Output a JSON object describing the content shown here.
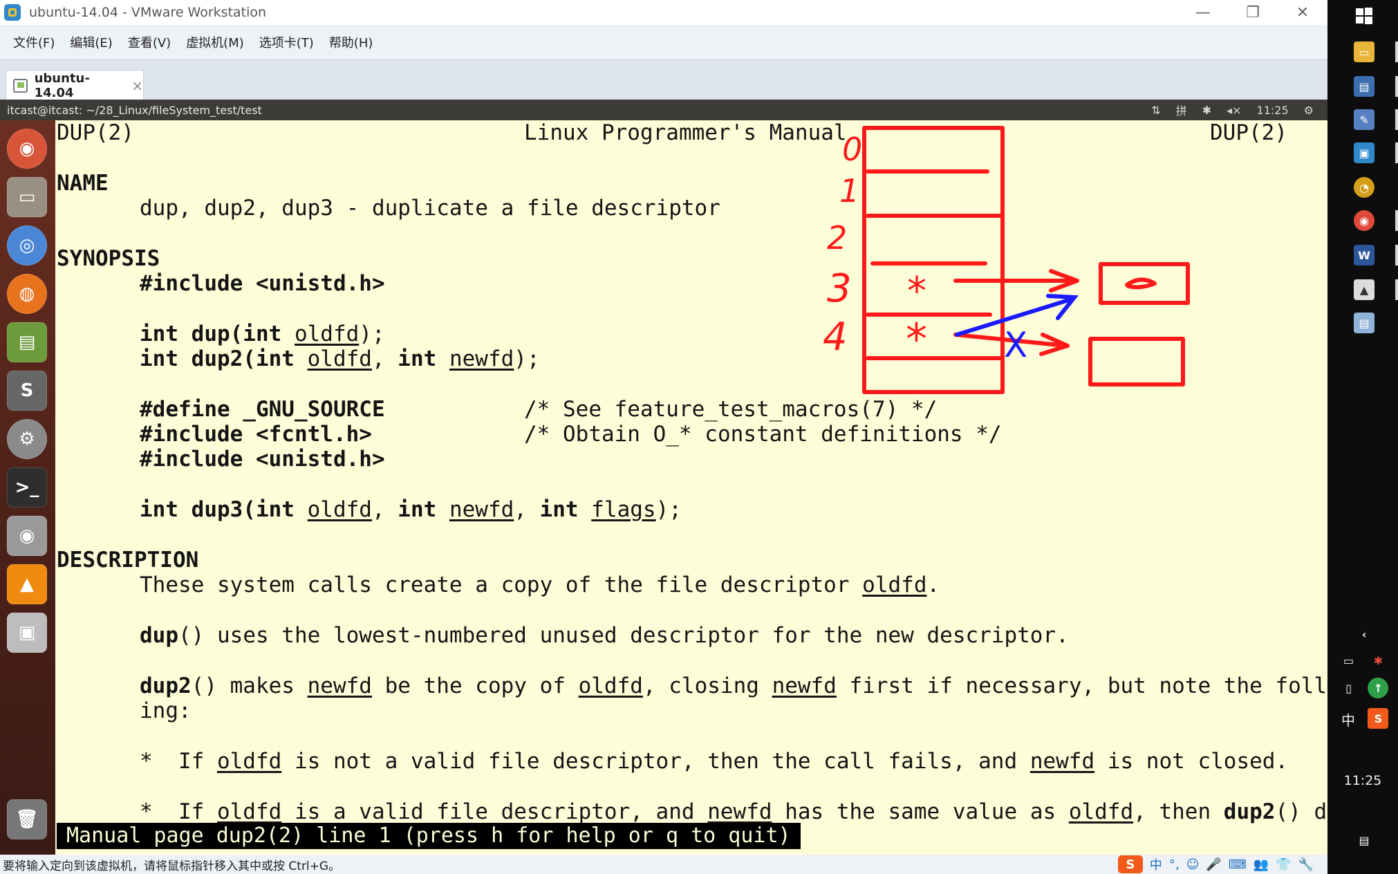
{
  "window": {
    "title": "ubuntu-14.04 - VMware Workstation",
    "controls": {
      "minimize": "—",
      "restore": "❐",
      "close": "✕"
    }
  },
  "menu": [
    "文件(F)",
    "编辑(E)",
    "查看(V)",
    "虚拟机(M)",
    "选项卡(T)",
    "帮助(H)"
  ],
  "tab": {
    "label": "ubuntu-14.04",
    "close": "×"
  },
  "guest": {
    "path": "itcast@itcast: ~/28_Linux/fileSystem_test/test",
    "indicators": [
      "⇅",
      "拼",
      "✱",
      "◂×",
      "11:25",
      "⚙"
    ],
    "launcher_icons": [
      "ubuntu-logo-icon",
      "files-icon",
      "chrome-icon",
      "firefox-icon",
      "book-icon",
      "sublime-icon",
      "settings-icon",
      "terminal-icon",
      "disk-icon",
      "vlc-icon",
      "save-icon",
      "trash-icon"
    ]
  },
  "man": {
    "header_left": "DUP(2)",
    "header_center": "Linux Programmer's Manual",
    "header_right": "DUP(2)",
    "name_heading": "NAME",
    "name_desc": "dup, dup2, dup3 - duplicate a file descriptor",
    "synopsis_heading": "SYNOPSIS",
    "include_unistd": "#include <unistd.h>",
    "dup_sig": [
      "int dup(int ",
      "oldfd",
      ");"
    ],
    "dup2_sig": [
      "int dup2(int ",
      "oldfd",
      ", ",
      "int ",
      "newfd",
      ");"
    ],
    "define_gnu": "#define _GNU_SOURCE",
    "define_gnu_comment": "/* See feature_test_macros(7) */",
    "include_fcntl": "#include <fcntl.h>",
    "include_fcntl_comment": "/* Obtain O_* constant definitions */",
    "include_unistd2": "#include <unistd.h>",
    "dup3_sig": [
      "int dup3(int ",
      "oldfd",
      ", ",
      "int ",
      "newfd",
      ", ",
      "int ",
      "flags",
      ");"
    ],
    "description_heading": "DESCRIPTION",
    "desc1": [
      "These system calls create a copy of the file descriptor ",
      "oldfd",
      "."
    ],
    "desc2": [
      "dup",
      "() uses the lowest-numbered unused descriptor for the new descriptor."
    ],
    "desc3": [
      "dup2",
      "() makes ",
      "newfd",
      " be the copy of ",
      "oldfd",
      ", closing ",
      "newfd",
      " first if necessary, but note the follow-"
    ],
    "desc3_cont": "ing:",
    "bullet1": [
      "*  If ",
      "oldfd",
      " is not a valid file descriptor, then the call fails, and ",
      "newfd",
      " is not closed."
    ],
    "bullet2": [
      "*  If ",
      "oldfd",
      " is a valid file descriptor, and ",
      "newfd",
      " has the same value as ",
      "oldfd",
      ", then ",
      "dup2",
      "() does"
    ],
    "status": "Manual page dup2(2) line 1 (press h for help or q to quit)"
  },
  "drawing": {
    "fd_labels": [
      "0",
      "1",
      "2",
      "3",
      "4"
    ],
    "marks": [
      "*",
      "*",
      "X"
    ],
    "colors": {
      "red": "#ff1a1a",
      "blue": "#1a1aff"
    }
  },
  "vm_status": {
    "message": "要将输入定向到该虚拟机，请将鼠标指针移入其中或按 Ctrl+G。",
    "tray": [
      "S",
      "中",
      "°,",
      "☺",
      "🎤",
      "⌨",
      "👥",
      "👕",
      "🔧"
    ]
  },
  "taskbar": {
    "clock": "11:25",
    "ime": "中",
    "chevron": "‹",
    "notify": "▤"
  },
  "colors": {
    "terminal_bg": "#fdfdd8",
    "launcher": "#4e2219",
    "topbar": "#3c3b37"
  }
}
